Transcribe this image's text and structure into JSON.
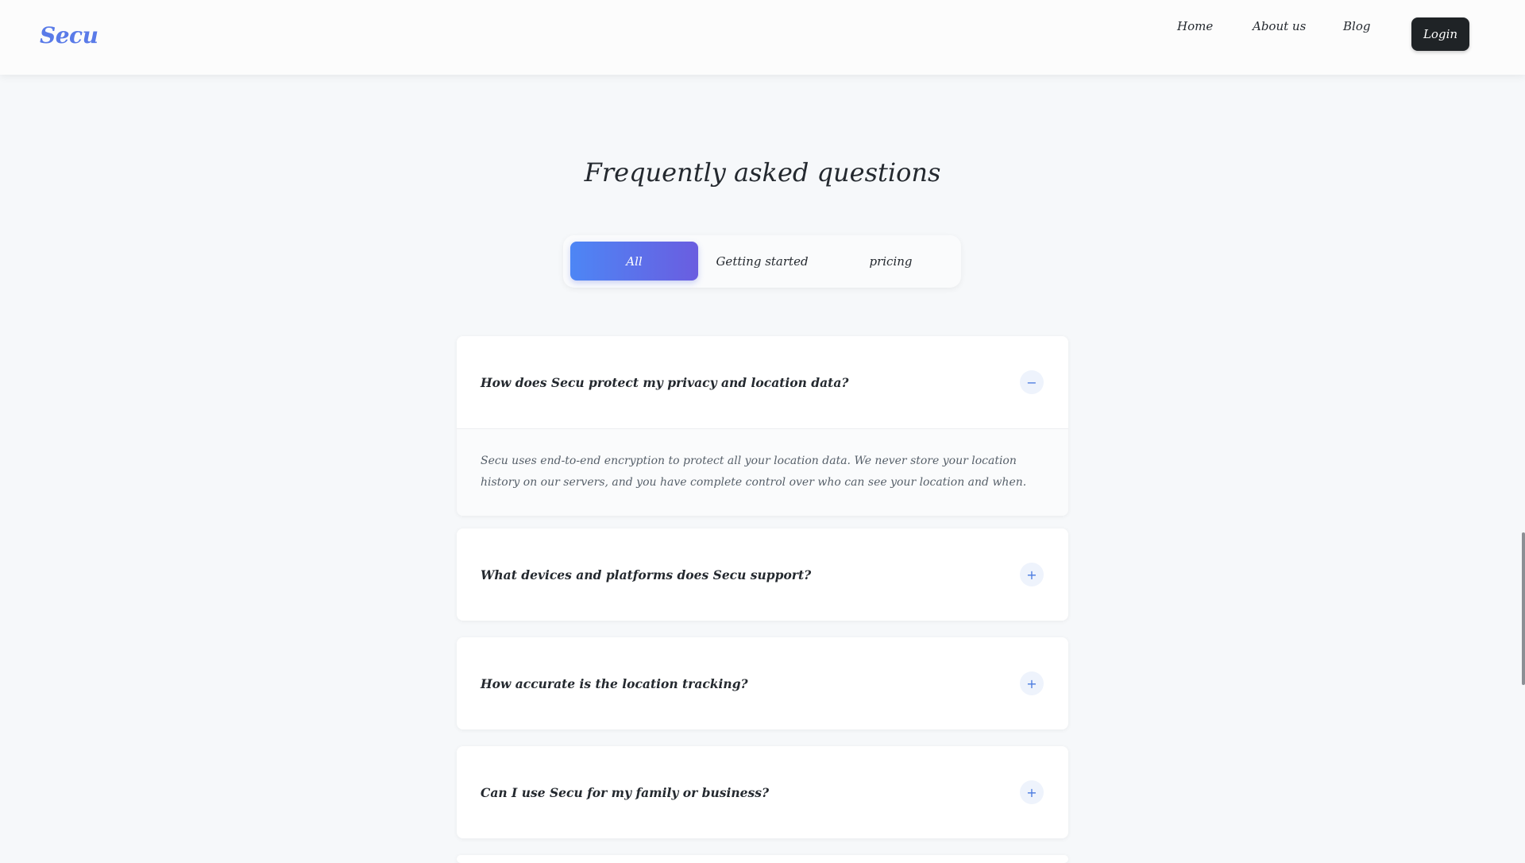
{
  "header": {
    "logo": "Secu",
    "nav": {
      "home": "Home",
      "about": "About us",
      "blog": "Blog"
    },
    "login_label": "Login"
  },
  "faq": {
    "title": "Frequently asked questions",
    "tabs": [
      {
        "label": "All",
        "active": true
      },
      {
        "label": "Getting started",
        "active": false
      },
      {
        "label": "pricing",
        "active": false
      }
    ],
    "items": [
      {
        "question": "How does Secu protect my privacy and location data?",
        "toggle": "−",
        "expanded": true,
        "answer": "Secu uses end-to-end encryption to protect all your location data. We never store your location history on our servers, and you have complete control over who can see your location and when."
      },
      {
        "question": "What devices and platforms does Secu support?",
        "toggle": "+",
        "expanded": false
      },
      {
        "question": "How accurate is the location tracking?",
        "toggle": "+",
        "expanded": false
      },
      {
        "question": "Can I use Secu for my family or business?",
        "toggle": "+",
        "expanded": false
      }
    ]
  },
  "colors": {
    "brand": "#5a7be8",
    "tab_gradient_start": "#4d86f5",
    "tab_gradient_end": "#6a5de0",
    "login_bg": "#1f2326",
    "toggle_accent": "#4a7be0"
  },
  "icons": {
    "collapse": "minus-icon",
    "expand": "plus-icon"
  }
}
